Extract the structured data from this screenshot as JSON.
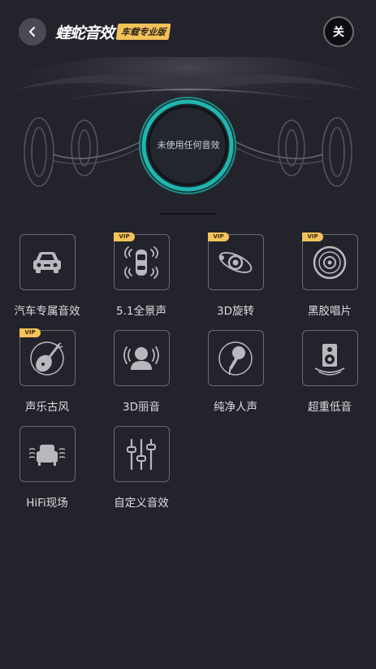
{
  "header": {
    "brand_logo": "蝰蛇音效",
    "brand_badge": "车载专业版",
    "close_label": "关"
  },
  "stage": {
    "status_text": "未使用任何音效"
  },
  "effects": [
    {
      "label": "汽车专属音效",
      "vip": false,
      "icon": "car-icon"
    },
    {
      "label": "5.1全景声",
      "vip": true,
      "icon": "surround-car-icon"
    },
    {
      "label": "3D旋转",
      "vip": true,
      "icon": "orbit-icon"
    },
    {
      "label": "黑胶唱片",
      "vip": true,
      "icon": "vinyl-record-icon"
    },
    {
      "label": "声乐古风",
      "vip": true,
      "icon": "pipa-lute-icon"
    },
    {
      "label": "3D丽音",
      "vip": false,
      "icon": "person-sound-icon"
    },
    {
      "label": "纯净人声",
      "vip": false,
      "icon": "microphone-icon"
    },
    {
      "label": "超重低音",
      "vip": false,
      "icon": "speaker-icon"
    },
    {
      "label": "HiFi现场",
      "vip": false,
      "icon": "armchair-icon"
    },
    {
      "label": "自定义音效",
      "vip": false,
      "icon": "equalizer-sliders-icon"
    }
  ],
  "vip_badge": "VIP",
  "colors": {
    "background": "#23232b",
    "accent_ring": "#1fb5b0",
    "vip": "#f4c25a"
  }
}
